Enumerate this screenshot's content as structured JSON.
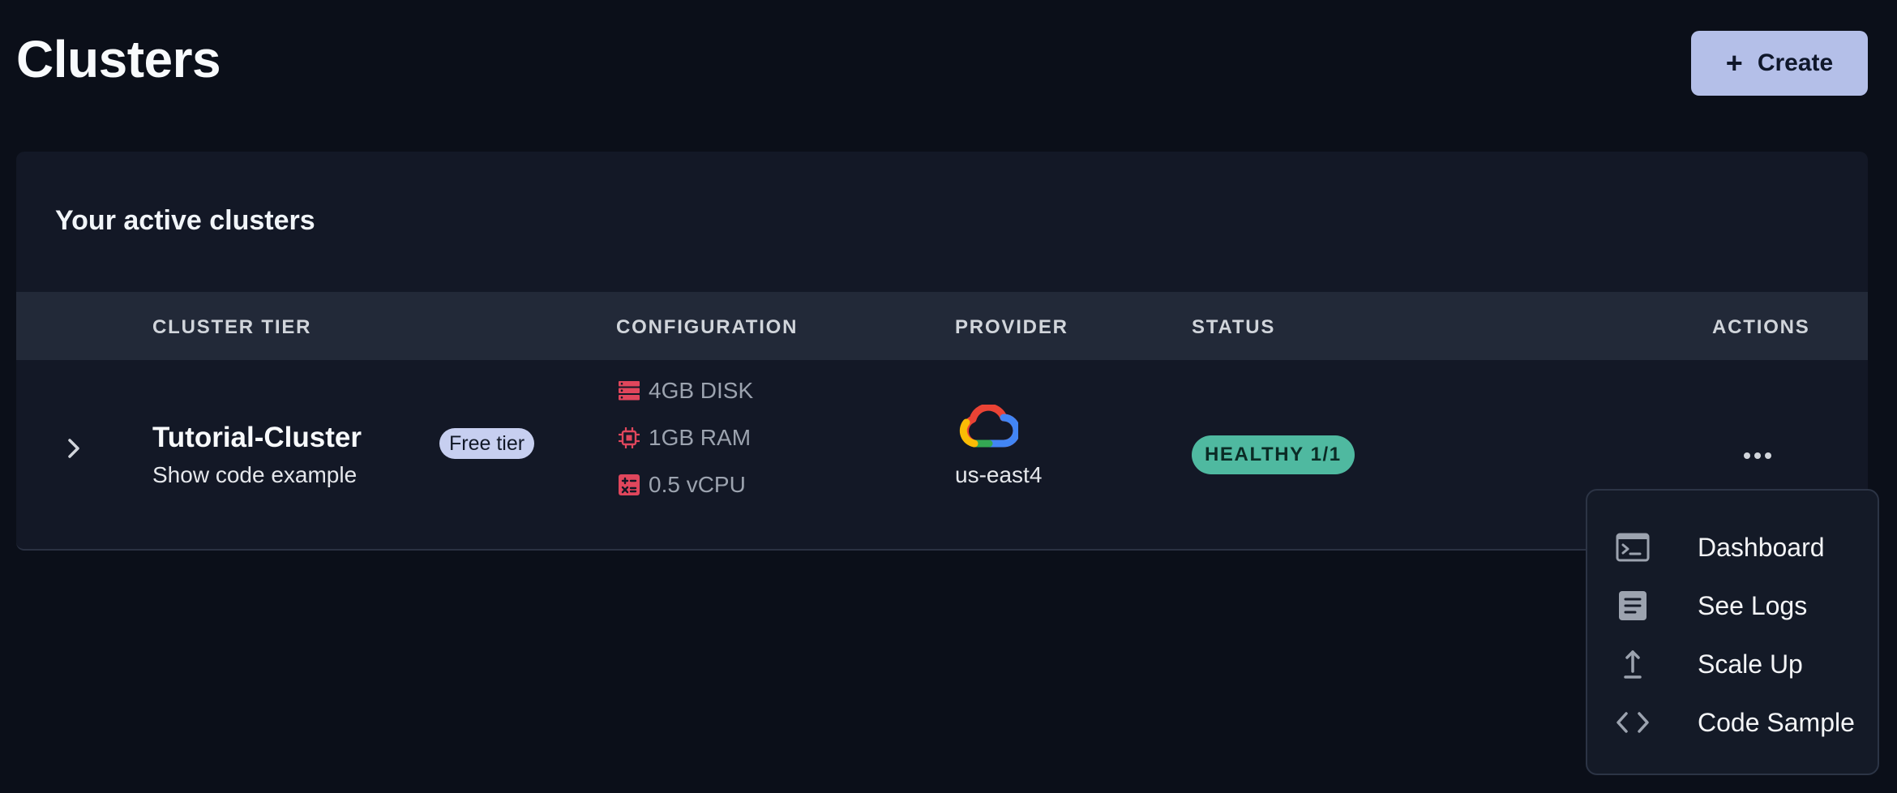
{
  "page": {
    "title": "Clusters",
    "create_label": "Create"
  },
  "clusters_card": {
    "heading": "Your active clusters",
    "columns": [
      "CLUSTER TIER",
      "CONFIGURATION",
      "PROVIDER",
      "STATUS",
      "ACTIONS"
    ],
    "rows": [
      {
        "name": "Tutorial-Cluster",
        "subtext": "Show code example",
        "tier_badge": "Free tier",
        "configuration": [
          {
            "icon": "storage-icon",
            "label": "4GB DISK"
          },
          {
            "icon": "memory-chip-icon",
            "label": "1GB RAM"
          },
          {
            "icon": "cpu-icon",
            "label": "0.5 vCPU"
          }
        ],
        "provider_icon": "google-cloud-icon",
        "region": "us-east4",
        "status": "HEALTHY 1/1"
      }
    ]
  },
  "actions_menu": {
    "items": [
      {
        "icon": "terminal-icon",
        "label": "Dashboard"
      },
      {
        "icon": "document-icon",
        "label": "See Logs"
      },
      {
        "icon": "upload-arrow-icon",
        "label": "Scale Up"
      },
      {
        "icon": "code-icon",
        "label": "Code Sample"
      }
    ]
  },
  "colors": {
    "background": "#0b0f19",
    "card": "#131826",
    "table_header": "#222938",
    "create_button": "#b4bfe8",
    "status_healthy": "#4fb9a0",
    "config_icon": "#e0465c",
    "free_tier_badge": "#c7cff0"
  }
}
